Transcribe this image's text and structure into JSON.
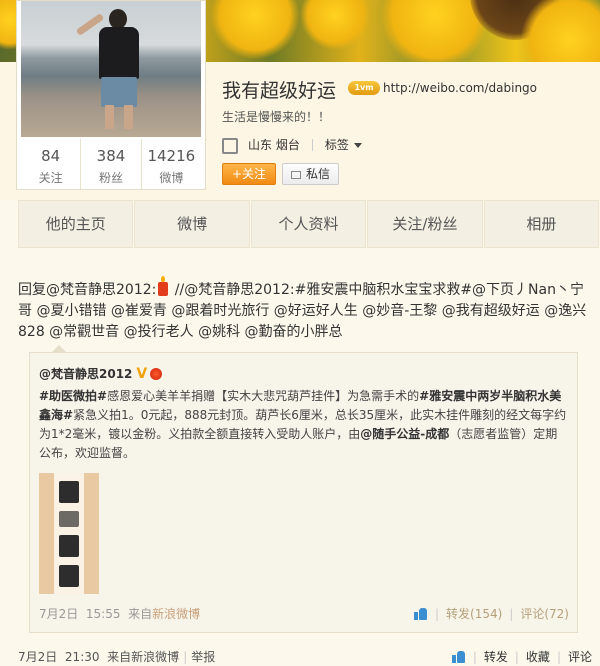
{
  "profile": {
    "name": "我有超级好运",
    "vip_badge": "1vm",
    "url": "http://weibo.com/dabingo",
    "bio": "生活是慢慢来的！！",
    "location": "山东 烟台",
    "tag_label": "标签",
    "follow_label": "+关注",
    "message_label": "私信",
    "stats": [
      {
        "value": "84",
        "label": "关注"
      },
      {
        "value": "384",
        "label": "粉丝"
      },
      {
        "value": "14216",
        "label": "微博"
      }
    ]
  },
  "nav": {
    "tabs": [
      "他的主页",
      "微博",
      "个人资料",
      "关注/粉丝",
      "相册"
    ]
  },
  "post": {
    "text_before_icon": "回复@梵音静思2012:",
    "text_after_icon": " //@梵音静思2012:#雅安震中脑积水宝宝求救#@下页丿Nan丶宁哥 @夏小错错 @崔爱青 @跟着时光旅行 @好运好人生 @妙音-王黎 @我有超级好运 @逸兴828 @常觀世音 @投行老人 @姚科 @勤奋的小胖总",
    "date": "7月2日",
    "time": "21:30",
    "source_prefix": "来自",
    "source": "新浪微博",
    "report": "举报",
    "actions": {
      "repost": "转发",
      "favorite": "收藏",
      "comment": "评论"
    }
  },
  "repost": {
    "author": "@梵音静思2012",
    "v_badge": "V",
    "tag1": "#助医微拍#",
    "text1": "感恩爱心美羊羊捐赠【实木大悲咒葫芦挂件】为急需手术的",
    "tag2": "#雅安震中两岁半脑积水美鑫海#",
    "text2": "紧急义拍1。0元起，888元封顶。葫芦长6厘米，总长35厘米，此实木挂件雕刻的经文每字约为1*2毫米，镀以金粉。义拍款全额直接转入受助人账户，由",
    "org": "@随手公益-成都",
    "text3": "（志愿者监管）定期公布，欢迎监督。",
    "date": "7月2日",
    "time": "15:55",
    "source_prefix": "来自",
    "source": "新浪微博",
    "repost_count": "转发(154)",
    "comment_count": "评论(72)"
  }
}
